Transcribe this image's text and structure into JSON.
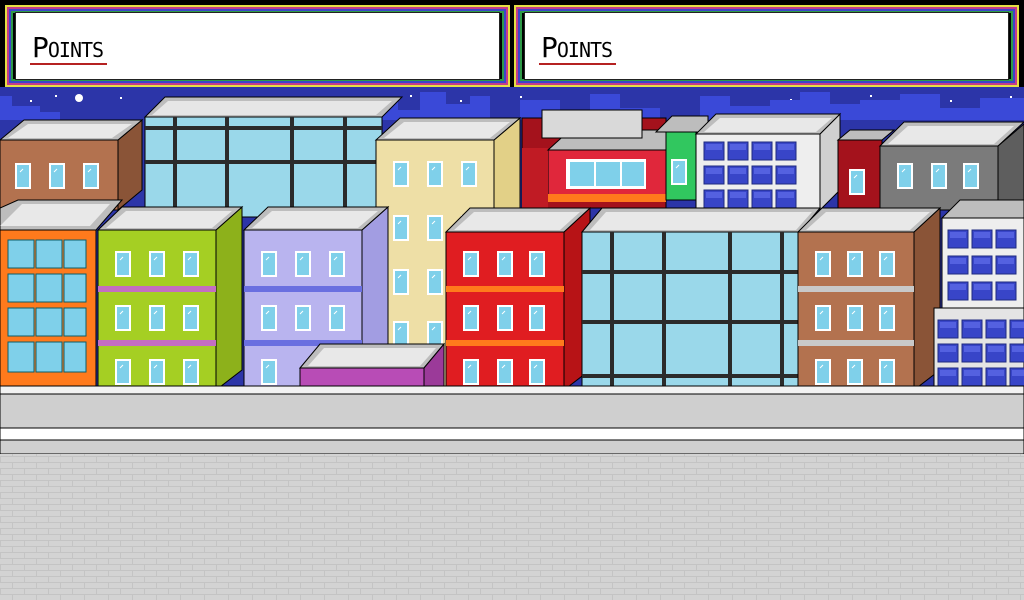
{
  "hud": {
    "player1_label": "Points",
    "player2_label": "Points"
  },
  "colors": {
    "sky": "#2c35a8",
    "skyline": "#3a49d8",
    "sidewalk": "#cfcfcf",
    "road": "#e0e0e0",
    "frame_yellow": "#e6e043",
    "frame_magenta": "#c43c8a",
    "frame_blue": "#3b46c8",
    "frame_green": "#2e9a48"
  },
  "buildings": [
    {
      "name": "brown-building",
      "color": "#b3724f"
    },
    {
      "name": "glass-tower",
      "color": "#9ad8ea"
    },
    {
      "name": "cream-building",
      "color": "#eedfa6"
    },
    {
      "name": "red-building",
      "color": "#e0273b"
    },
    {
      "name": "green-building",
      "color": "#31c75f"
    },
    {
      "name": "white-office-building",
      "color": "#eeeeee"
    },
    {
      "name": "dark-red-building",
      "color": "#a4121c"
    },
    {
      "name": "gray-building",
      "color": "#7b7b7b"
    },
    {
      "name": "orange-building",
      "color": "#ff7a1c"
    },
    {
      "name": "lime-building",
      "color": "#a5cf23"
    },
    {
      "name": "lavender-building",
      "color": "#b9b4ef"
    },
    {
      "name": "purple-building",
      "color": "#b84cb6"
    },
    {
      "name": "red-front-building",
      "color": "#e01d21"
    },
    {
      "name": "glass-front-building",
      "color": "#9ad8ea"
    },
    {
      "name": "brown-front-building",
      "color": "#b3724f"
    },
    {
      "name": "blue-window-building",
      "color": "#eeeeee"
    }
  ]
}
